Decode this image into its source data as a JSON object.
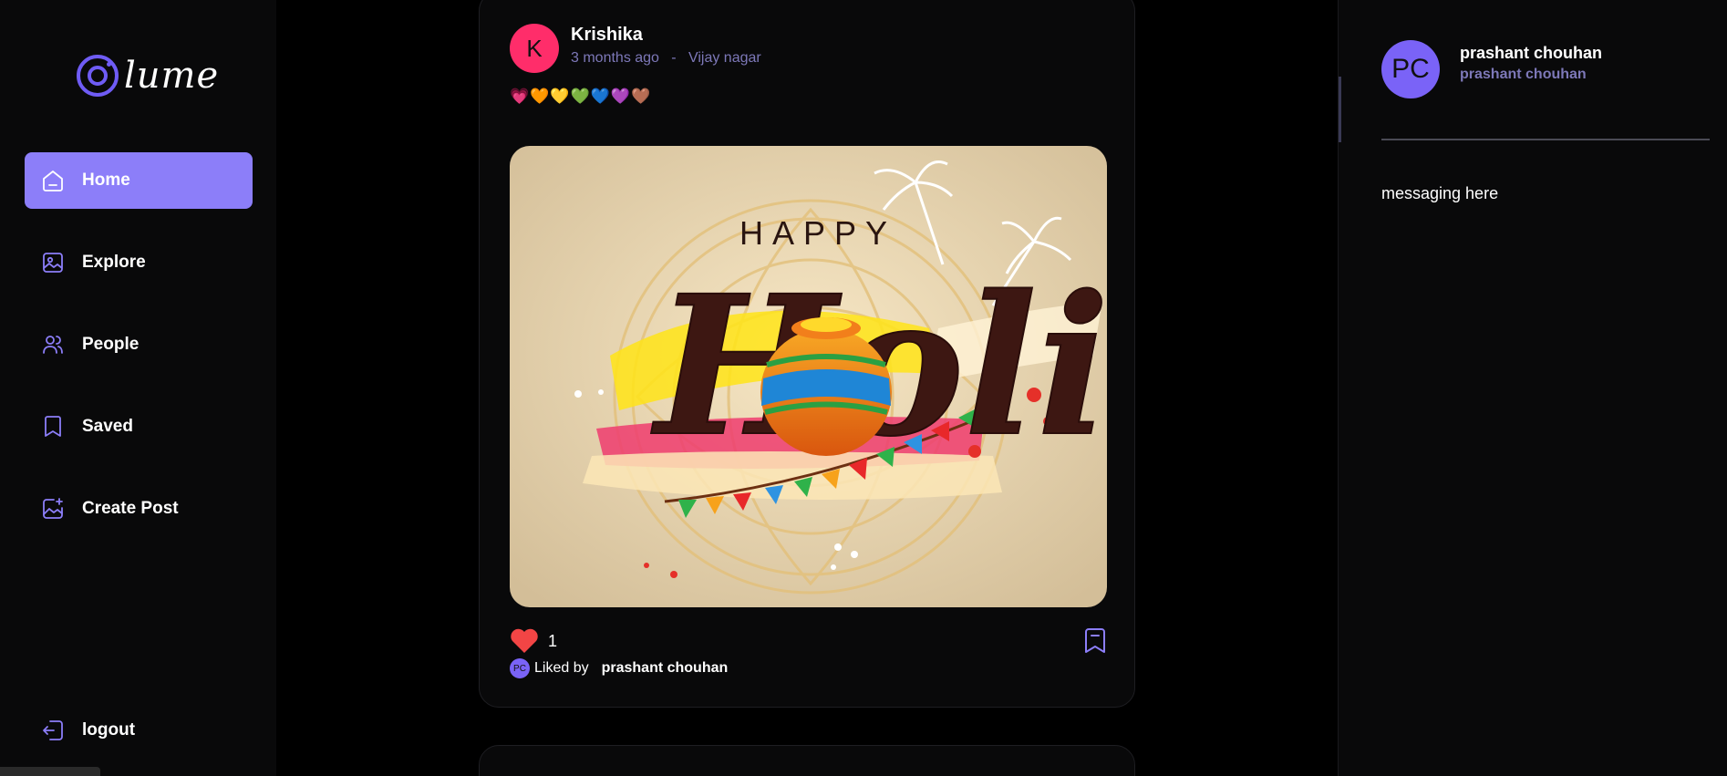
{
  "app": {
    "logo_text": "lume",
    "accent_color": "#8c7ef9"
  },
  "nav": {
    "items": [
      {
        "label": "Home",
        "icon": "home-icon",
        "active": true
      },
      {
        "label": "Explore",
        "icon": "gallery-icon",
        "active": false
      },
      {
        "label": "People",
        "icon": "people-icon",
        "active": false
      },
      {
        "label": "Saved",
        "icon": "bookmark-icon",
        "active": false
      },
      {
        "label": "Create Post",
        "icon": "image-add-icon",
        "active": false
      }
    ],
    "logout_label": "logout"
  },
  "post": {
    "avatar_initial": "K",
    "author": "Krishika",
    "time": "3 months ago",
    "separator": "-",
    "location": "Vijay nagar",
    "caption": "💗🧡💛💚💙💜🤎",
    "image": {
      "happy_text": "HAPPY",
      "holi_text": "Holi"
    },
    "like_count": "1",
    "liked_by_avatar": "PC",
    "liked_by_label": "Liked by",
    "liked_by_name": "prashant chouhan"
  },
  "profile": {
    "avatar_initials": "PC",
    "name": "prashant chouhan",
    "username": "prashant chouhan",
    "messaging_text": "messaging here"
  }
}
